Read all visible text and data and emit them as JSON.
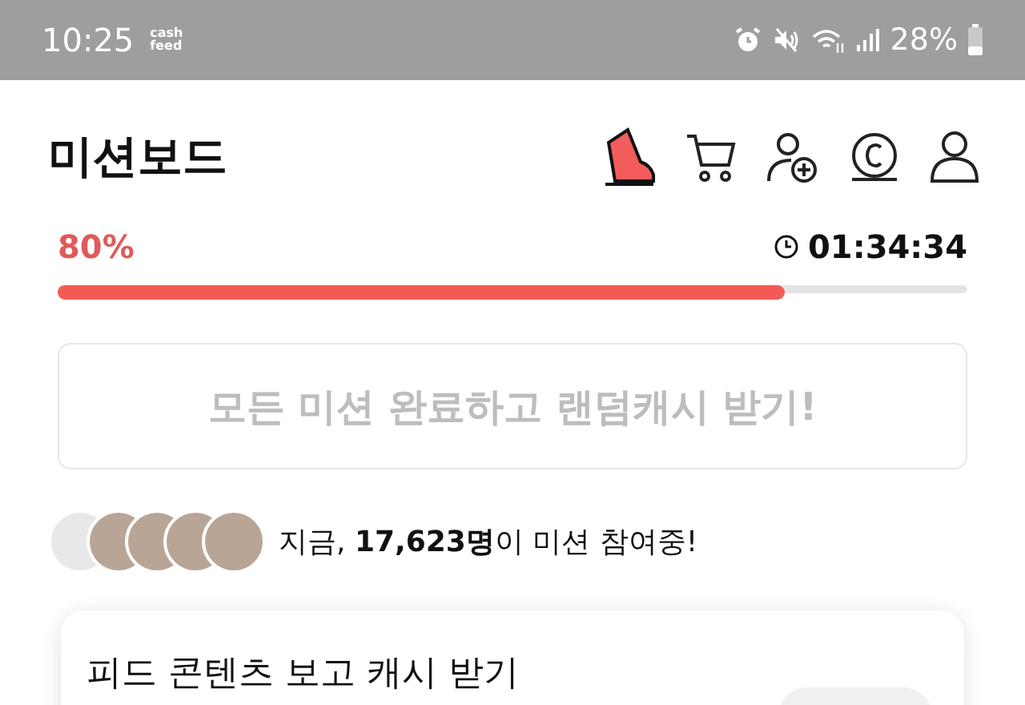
{
  "status_bar": {
    "time": "10:25",
    "app_badge": [
      "cash",
      "feed"
    ],
    "battery": "28%"
  },
  "header": {
    "title": "미션보드"
  },
  "progress": {
    "percent": "80%",
    "timer": "01:34:34",
    "level": 0.8
  },
  "reward_button": {
    "label": "모든 미션 완료하고 랜덤캐시 받기!",
    "disabled": true
  },
  "participants": {
    "text": "지금, **17,623명**이 미션 참여중!"
  },
  "mission_card": {
    "title": "피드 콘텐츠 보고 캐시 받기"
  }
}
